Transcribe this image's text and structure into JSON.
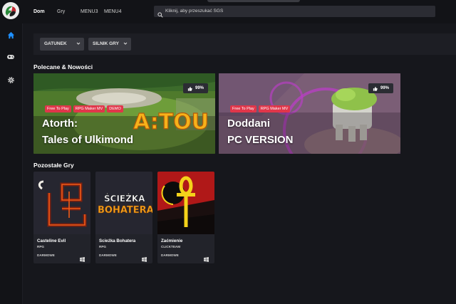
{
  "nav": {
    "items": [
      "Dom",
      "Gry",
      "MENU3",
      "MENU4"
    ],
    "search_placeholder": "Kliknij, aby przeszukać SGS"
  },
  "sidebar": {
    "icons": [
      "home-icon",
      "gamepad-icon",
      "settings-icon"
    ],
    "active_color": "#1e90ff"
  },
  "filters": {
    "genre_label": "GATUNEK",
    "engine_label": "SILNIK GRY"
  },
  "sections": {
    "featured_heading": "Polecane & Nowości",
    "others_heading": "Pozostałe Gry"
  },
  "featured": [
    {
      "title_line1": "Atorth:",
      "title_line2": "Tales of Ulkimond",
      "rating": "99%",
      "tags": [
        "Free To Play",
        "RPG Maker MV",
        "DEMO"
      ],
      "logo_text": "A:TOU"
    },
    {
      "title_line1": "Doddani",
      "title_line2": "PC VERSION",
      "rating": "99%",
      "tags": [
        "Free To Play",
        "RPG Maker MV"
      ]
    }
  ],
  "games": [
    {
      "title": "Casteline Evil",
      "genre": "RPG",
      "price": "DARMOWE"
    },
    {
      "title": "Scieżka Bohatera",
      "genre": "RPG",
      "price": "DARMOWE",
      "logo_line1": "ŚCIEŻKA",
      "logo_line2": "BOHATERA"
    },
    {
      "title": "Zaćmienie",
      "genre": "CLICKTEAM",
      "price": "DARMOWE"
    }
  ],
  "colors": {
    "accent": "#1e90ff",
    "tag_red": "#e0364a",
    "background": "#16171c"
  }
}
